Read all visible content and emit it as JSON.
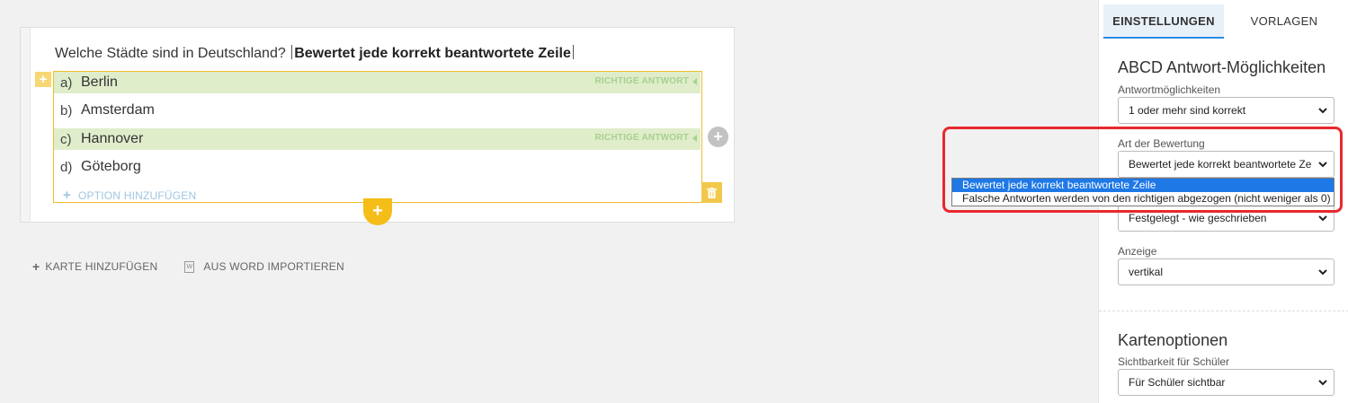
{
  "question": {
    "text": "Welche Städte sind in Deutschland? ",
    "bold_text": "Bewertet jede korrekt beantwortete Zeile"
  },
  "options": [
    {
      "letter": "a)",
      "text": "Berlin",
      "correct": true
    },
    {
      "letter": "b)",
      "text": "Amsterdam",
      "correct": false
    },
    {
      "letter": "c)",
      "text": "Hannover",
      "correct": true
    },
    {
      "letter": "d)",
      "text": "Göteborg",
      "correct": false
    }
  ],
  "correct_badge": "RICHTIGE ANTWORT",
  "add_option_label": "OPTION HINZUFÜGEN",
  "actions": {
    "add_card": "KARTE HINZUFÜGEN",
    "import_word": "AUS WORD IMPORTIEREN",
    "word_icon": "W"
  },
  "panel": {
    "tabs": [
      {
        "label": "EINSTELLUNGEN",
        "active": true
      },
      {
        "label": "VORLAGEN",
        "active": false
      }
    ],
    "section1_title": "ABCD Antwort-Möglichkeiten",
    "answer_options": {
      "label": "Antwortmöglichkeiten",
      "value": "1 oder mehr sind korrekt"
    },
    "grading": {
      "label": "Art der Bewertung",
      "value": "Bewertet jede korrekt beantwortete Ze"
    },
    "order": {
      "value": "Festgelegt - wie geschrieben"
    },
    "display": {
      "label": "Anzeige",
      "value": "vertikal"
    },
    "section2_title": "Kartenoptionen",
    "visibility": {
      "label": "Sichtbarkeit für Schüler",
      "value": "Für Schüler sichtbar"
    }
  },
  "dropdown": {
    "options": [
      {
        "label": "Bewertet jede korrekt beantwortete Zeile",
        "selected": true
      },
      {
        "label": "Falsche Antworten werden von den richtigen abgezogen (nicht weniger als 0)",
        "selected": false
      }
    ]
  },
  "colors": {
    "accent": "#f5bd18",
    "correct_bg": "#dfedcb",
    "tab_active": "#2b8be5",
    "highlight": "#e8282d",
    "selected_option": "#1e78e6"
  }
}
